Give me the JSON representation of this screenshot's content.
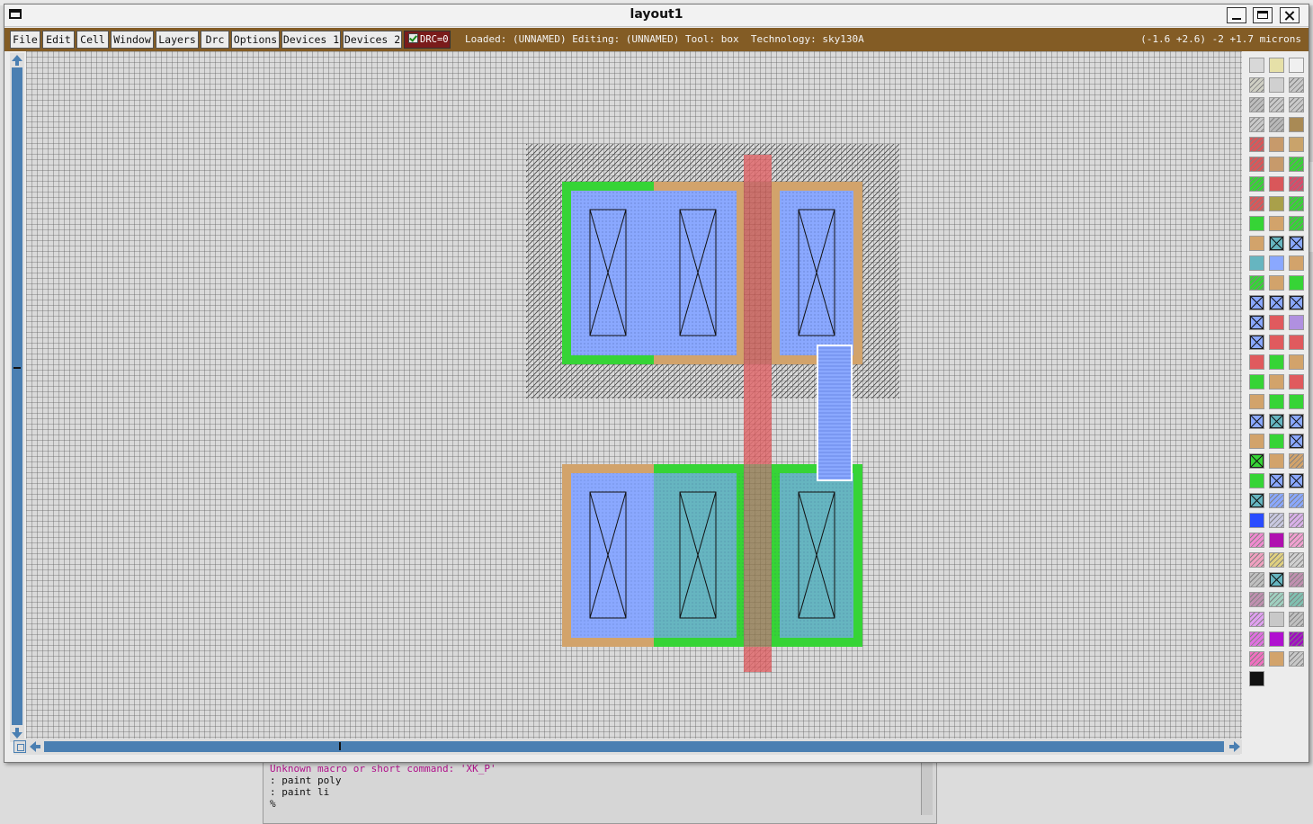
{
  "window": {
    "title": "layout1"
  },
  "menubar": {
    "items": [
      "File",
      "Edit",
      "Cell",
      "Window",
      "Layers",
      "Drc",
      "Options",
      "Devices 1",
      "Devices 2"
    ],
    "drc_label": "DRC=0"
  },
  "status": {
    "text": "Loaded: (UNNAMED) Editing: (UNNAMED) Tool: box  Technology: sky130A",
    "coords": "(-1.6 +2.6) -2 +1.7 microns"
  },
  "console": {
    "lines": [
      {
        "text": "Unknown macro or short command: 'XK_P'",
        "kind": "error"
      },
      {
        "text": ": paint poly",
        "kind": "normal"
      },
      {
        "text": ": paint li",
        "kind": "normal"
      },
      {
        "text": "%",
        "kind": "normal"
      }
    ]
  },
  "colors": {
    "menubar_bg": "#835c25",
    "drc_bg": "#7a1b1b",
    "scroll_accent": "#4a7fb2",
    "poly": "#d9575a",
    "li": "#8aa8ff",
    "diffusion_n": "#36d436",
    "diffusion_p": "#d2a36b",
    "nwell_hatch": "#555555"
  },
  "layout": {
    "tool": "box",
    "technology": "sky130A",
    "layers_visible": [
      "nwell",
      "pdiffusion",
      "ndiffusion",
      "poly",
      "li",
      "licon"
    ]
  },
  "palette": {
    "swatch_count": 103
  }
}
